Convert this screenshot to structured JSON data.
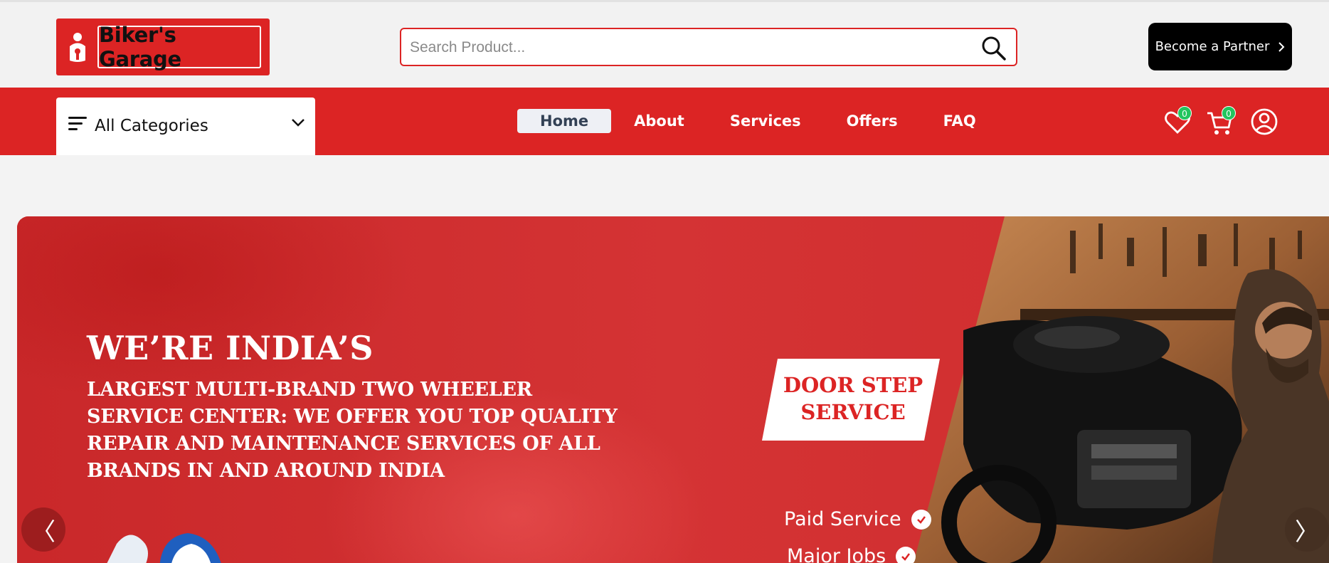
{
  "brand": {
    "name": "Biker's Garage",
    "color": "#dc2424"
  },
  "search": {
    "placeholder": "Search Product..."
  },
  "header": {
    "partner_label": "Become a Partner"
  },
  "nav": {
    "categories_label": "All Categories",
    "links": [
      {
        "label": "Home",
        "active": true
      },
      {
        "label": "About"
      },
      {
        "label": "Services"
      },
      {
        "label": "Offers"
      },
      {
        "label": "FAQ"
      }
    ],
    "wishlist_count": "0",
    "cart_count": "0"
  },
  "hero": {
    "title": "WE’RE INDIA’S",
    "subtitle": "LARGEST MULTI-BRAND TWO WHEELER SERVICE CENTER: WE OFFER YOU TOP QUALITY REPAIR AND MAINTENANCE SERVICES OF ALL BRANDS IN AND AROUND INDIA",
    "badge_line1": "DOOR STEP",
    "badge_line2": "SERVICE",
    "services": [
      "Paid Service",
      "Major Jobs"
    ],
    "prev_arrow": "〈",
    "next_arrow": "〉"
  },
  "icons": {
    "logo": "mascot-icon",
    "search": "search-icon",
    "partner": "chevron-right-icon",
    "categories": "menu-lines-icon",
    "categories_toggle": "chevron-down-icon",
    "wishlist": "heart-icon",
    "cart": "cart-icon",
    "account": "user-circle-icon"
  },
  "colors": {
    "accent": "#dc2424",
    "badge": "#22c55e",
    "partner_bg": "#000000"
  }
}
